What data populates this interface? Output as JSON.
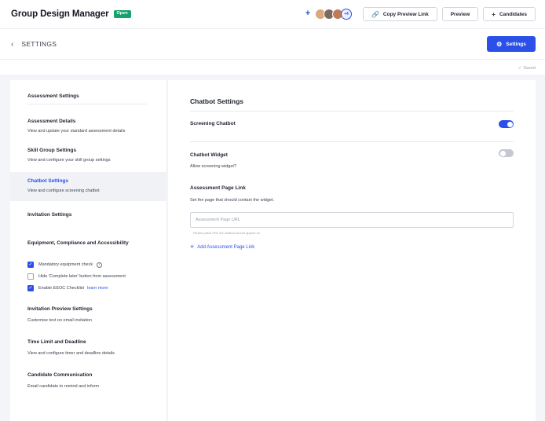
{
  "header": {
    "app_title": "Group Design Manager",
    "status": "Open",
    "add_icon": "+",
    "avatars_more": "+4",
    "copy_preview_link": "Copy Preview Link",
    "preview": "Preview",
    "candidates": "Candidates"
  },
  "subheader": {
    "title": "SETTINGS",
    "settings_button": "Settings"
  },
  "save_status": "Saved",
  "sidebar": {
    "heading": "Assessment Settings",
    "items": [
      {
        "title": "Assessment Details",
        "desc": "View and update your standard assessment details"
      },
      {
        "title": "Skill Group Settings",
        "desc": "View and configure your skill group settings"
      },
      {
        "title": "Chatbot Settings",
        "desc": "View and configure screening chatbot"
      },
      {
        "title": "Invitation Settings"
      },
      {
        "title": "Equipment, Compliance and Accessibility"
      },
      {
        "title": "Invitation Preview Settings",
        "desc": "Customise text on email invitation"
      },
      {
        "title": "Time Limit and Deadline",
        "desc": "View and configure timer and deadline details"
      },
      {
        "title": "Candidate Communication",
        "desc": "Email candidate to remind and inform"
      }
    ],
    "checks": [
      {
        "label": "Mandatory equipment check",
        "checked": true
      },
      {
        "label": "Hide 'Complete later' button from assessment",
        "checked": false
      },
      {
        "label": "Enable EEOC Checklist",
        "checked": true,
        "link": "learn more"
      }
    ]
  },
  "main": {
    "title": "Chatbot Settings",
    "screening_chatbot": {
      "label": "Screening Chatbot",
      "enabled": true
    },
    "chatbot_widget": {
      "label": "Chatbot Widget",
      "desc": "Allow screening widget?",
      "enabled": false
    },
    "page_link": {
      "label": "Assessment Page Link",
      "desc": "Set the page that should contain the widget.",
      "placeholder": "Assessment Page URL",
      "hint": "Please paste URL the chatbot should appear on",
      "add_label": "Add Assessment Page Link"
    }
  },
  "colors": {
    "accent": "#2a50e8",
    "status_green": "#14a36a"
  }
}
